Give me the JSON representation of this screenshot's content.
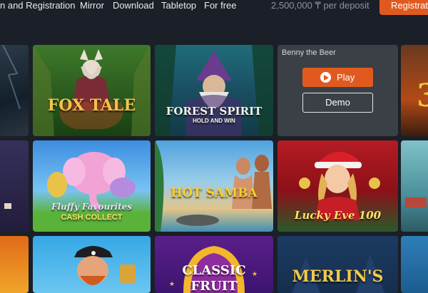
{
  "header": {
    "nav": [
      "n and Registration",
      "Mirror",
      "Download",
      "Tabletop",
      "For free"
    ],
    "deposit_text": "2,500,000 ₸ per deposit",
    "register_label": "Registrati"
  },
  "games": {
    "fox_tale": "FOX TALE",
    "forest_spirit": "FOREST SPIRIT",
    "forest_spirit_sub": "HOLD AND WIN",
    "benny": {
      "name": "Benny the Beer",
      "play_label": "Play",
      "demo_label": "Demo"
    },
    "fluffy_line1": "Fluffy Favourites",
    "fluffy_line2": "CASH COLLECT",
    "hot_samba": "HOT SAMBA",
    "lucky_eve": "Lucky Eve 100",
    "classic": "CLASSIC",
    "classic2": "FRUIT",
    "merlins": "MERLIN'S"
  },
  "colors": {
    "accent": "#e05a20",
    "background": "#1b1f27"
  }
}
